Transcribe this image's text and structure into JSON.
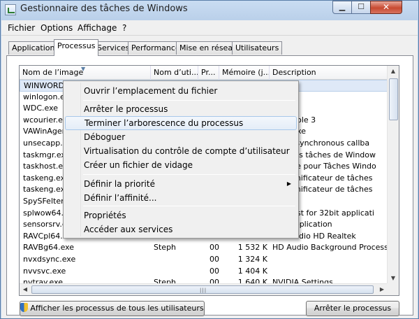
{
  "window": {
    "title": "Gestionnaire des tâches de Windows"
  },
  "menubar": {
    "items": [
      "Fichier",
      "Options",
      "Affichage",
      "?"
    ]
  },
  "tabs": [
    "Applications",
    "Processus",
    "Services",
    "Performance",
    "Mise en réseau",
    "Utilisateurs"
  ],
  "active_tab": "Processus",
  "columns": [
    "Nom de l’image",
    "Nom d’uti...",
    "Pr...",
    "Mémoire (j...",
    "Description"
  ],
  "processes": [
    {
      "image": "WINWORD.E",
      "user": "",
      "cpu": "",
      "mem": "",
      "desc": "t Word"
    },
    {
      "image": "winlogon.ex",
      "user": "",
      "cpu": "",
      "mem": "",
      "desc": ""
    },
    {
      "image": "WDC.exe",
      "user": "",
      "cpu": "",
      "mem": "",
      "desc": ""
    },
    {
      "image": "wcourier.ex",
      "user": "",
      "cpu": "",
      "mem": "",
      "desc": "r Console 3"
    },
    {
      "image": "VAWinAgent",
      "user": "",
      "cpu": "",
      "mem": "",
      "desc": "gent.exe"
    },
    {
      "image": "unsecapp.ex",
      "user": "",
      "cpu": "",
      "mem": "",
      "desc": "eive asynchronous callba"
    },
    {
      "image": "taskmgr.exe",
      "user": "",
      "cpu": "",
      "mem": "",
      "desc": "aire des tâches de Window"
    },
    {
      "image": "taskhost.exe",
      "user": "",
      "cpu": "",
      "mem": "",
      "desc": "us hôte pour Tâches Windo"
    },
    {
      "image": "taskeng.exe",
      "user": "",
      "cpu": "",
      "mem": "",
      "desc": "du Planificateur de tâches"
    },
    {
      "image": "taskeng.exe",
      "user": "",
      "cpu": "",
      "mem": "",
      "desc": "du Planificateur de tâches"
    },
    {
      "image": "SpySFelter.e",
      "user": "",
      "cpu": "",
      "mem": "",
      "desc": "r GUI"
    },
    {
      "image": "splwow64.ex",
      "user": "",
      "cpu": "",
      "mem": "",
      "desc": "ver host for 32bit applicati"
    },
    {
      "image": "sensorsrv.e",
      "user": "",
      "cpu": "",
      "mem": "",
      "desc": "gon Application"
    },
    {
      "image": "RAVCpl64.ex",
      "user": "",
      "cpu": "",
      "mem": "",
      "desc": "aire audio HD Realtek"
    },
    {
      "image": "RAVBg64.exe",
      "user": "Steph",
      "cpu": "00",
      "mem": "1 532 K",
      "desc": "HD Audio Background Process"
    },
    {
      "image": "nvxdsync.exe",
      "user": "",
      "cpu": "00",
      "mem": "1 324 K",
      "desc": ""
    },
    {
      "image": "nvvsvc.exe",
      "user": "",
      "cpu": "00",
      "mem": "1 404 K",
      "desc": ""
    },
    {
      "image": "nvtray.exe",
      "user": "Steph",
      "cpu": "00",
      "mem": "1 640 K",
      "desc": "NVIDIA Settings"
    }
  ],
  "context_menu": {
    "items": [
      {
        "label": "Ouvrir l’emplacement du fichier"
      },
      {
        "label": "Arrêter le processus"
      },
      {
        "label": "Terminer l’arborescence du processus",
        "hover": true
      },
      {
        "label": "Déboguer"
      },
      {
        "label": "Virtualisation du contrôle de compte d’utilisateur"
      },
      {
        "label": "Créer un fichier de vidage"
      },
      {
        "label": "Définir la priorité",
        "submenu": true
      },
      {
        "label": "Définir l’affinité..."
      },
      {
        "label": "Propriétés"
      },
      {
        "label": "Accéder aux services"
      }
    ]
  },
  "buttons": {
    "show_all": "Afficher les processus de tous les utilisateurs",
    "end_process": "Arrêter le processus"
  },
  "icons": {
    "shield": "uac-shield-icon",
    "app": "task-manager-icon"
  }
}
